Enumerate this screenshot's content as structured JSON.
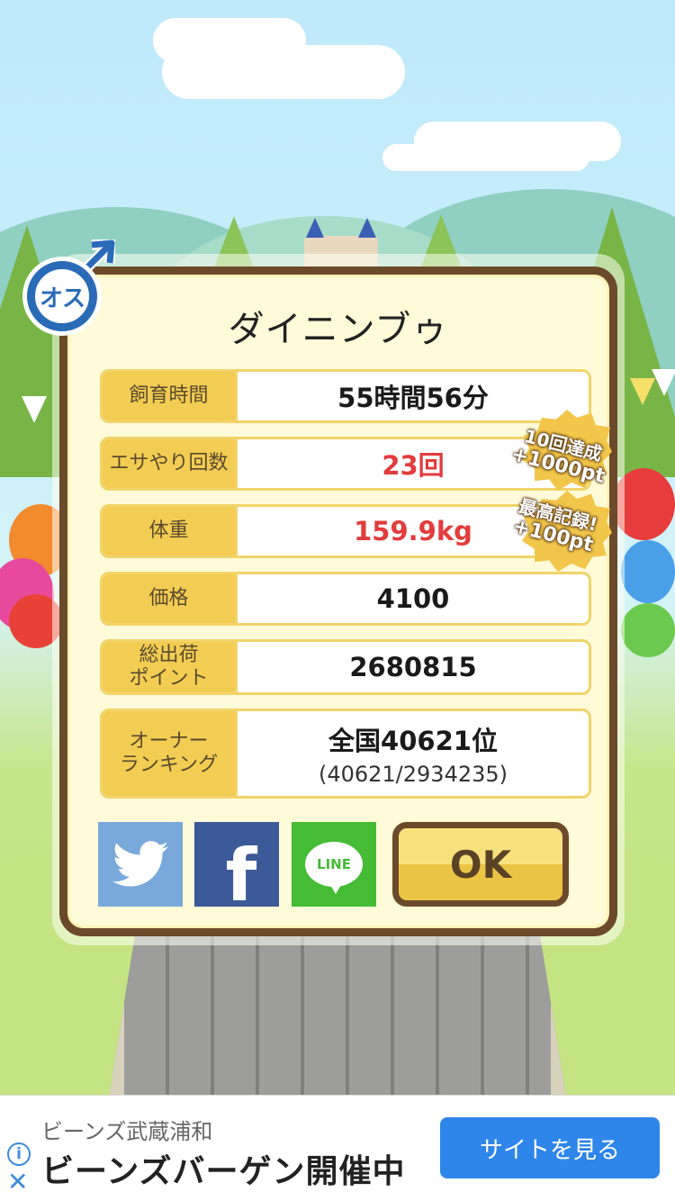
{
  "pet": {
    "name": "ダイニンブゥ",
    "gender_label": "オス"
  },
  "stats": [
    {
      "label": "飼育時間",
      "value": "55時間56分",
      "highlight": false
    },
    {
      "label": "エサやり回数",
      "value": "23回",
      "highlight": true
    },
    {
      "label": "体重",
      "value": "159.9kg",
      "highlight": true
    },
    {
      "label": "価格",
      "value": "4100",
      "highlight": false
    },
    {
      "label": "総出荷\nポイント",
      "value": "2680815",
      "highlight": false
    },
    {
      "label": "オーナー\nランキング",
      "value": "全国40621位",
      "sub_value": "(40621/2934235)",
      "highlight": false
    }
  ],
  "badges": [
    {
      "line1": "10回達成",
      "line2": "+1000pt"
    },
    {
      "line1": "最高記録!",
      "line2": "+100pt"
    }
  ],
  "share": {
    "twitter_icon": "twitter-bird-icon",
    "facebook_glyph": "f",
    "line_label": "LINE"
  },
  "ok_button": {
    "label": "OK"
  },
  "ad": {
    "store": "ビーンズ武蔵浦和",
    "headline": "ビーンズバーゲン開催中",
    "cta": "サイトを見る",
    "info_glyph": "i",
    "close_glyph": "✕"
  },
  "colors": {
    "panel_border": "#6b4a2b",
    "label_bg": "#f3cd53",
    "highlight_text": "#e23c3c",
    "male_blue": "#2a6bb8",
    "ad_cta": "#2f86ea"
  }
}
